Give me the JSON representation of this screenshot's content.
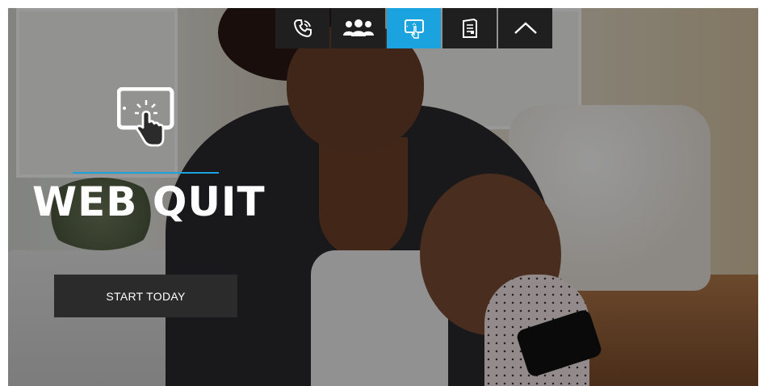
{
  "nav": {
    "items": [
      {
        "icon": "phone-icon",
        "label": "Phone"
      },
      {
        "icon": "group-icon",
        "label": "Group"
      },
      {
        "icon": "web-tablet-icon",
        "label": "Web",
        "active": true
      },
      {
        "icon": "guide-document-icon",
        "label": "Guide"
      },
      {
        "icon": "chevron-up-icon",
        "label": "Collapse"
      }
    ],
    "active_color": "#1aa3de",
    "bg_color": "#1f1f1f"
  },
  "hero": {
    "icon": "tablet-touch-icon",
    "title": "WEB QUIT",
    "accent_color": "#1aa3de",
    "cta_label": "START TODAY"
  }
}
